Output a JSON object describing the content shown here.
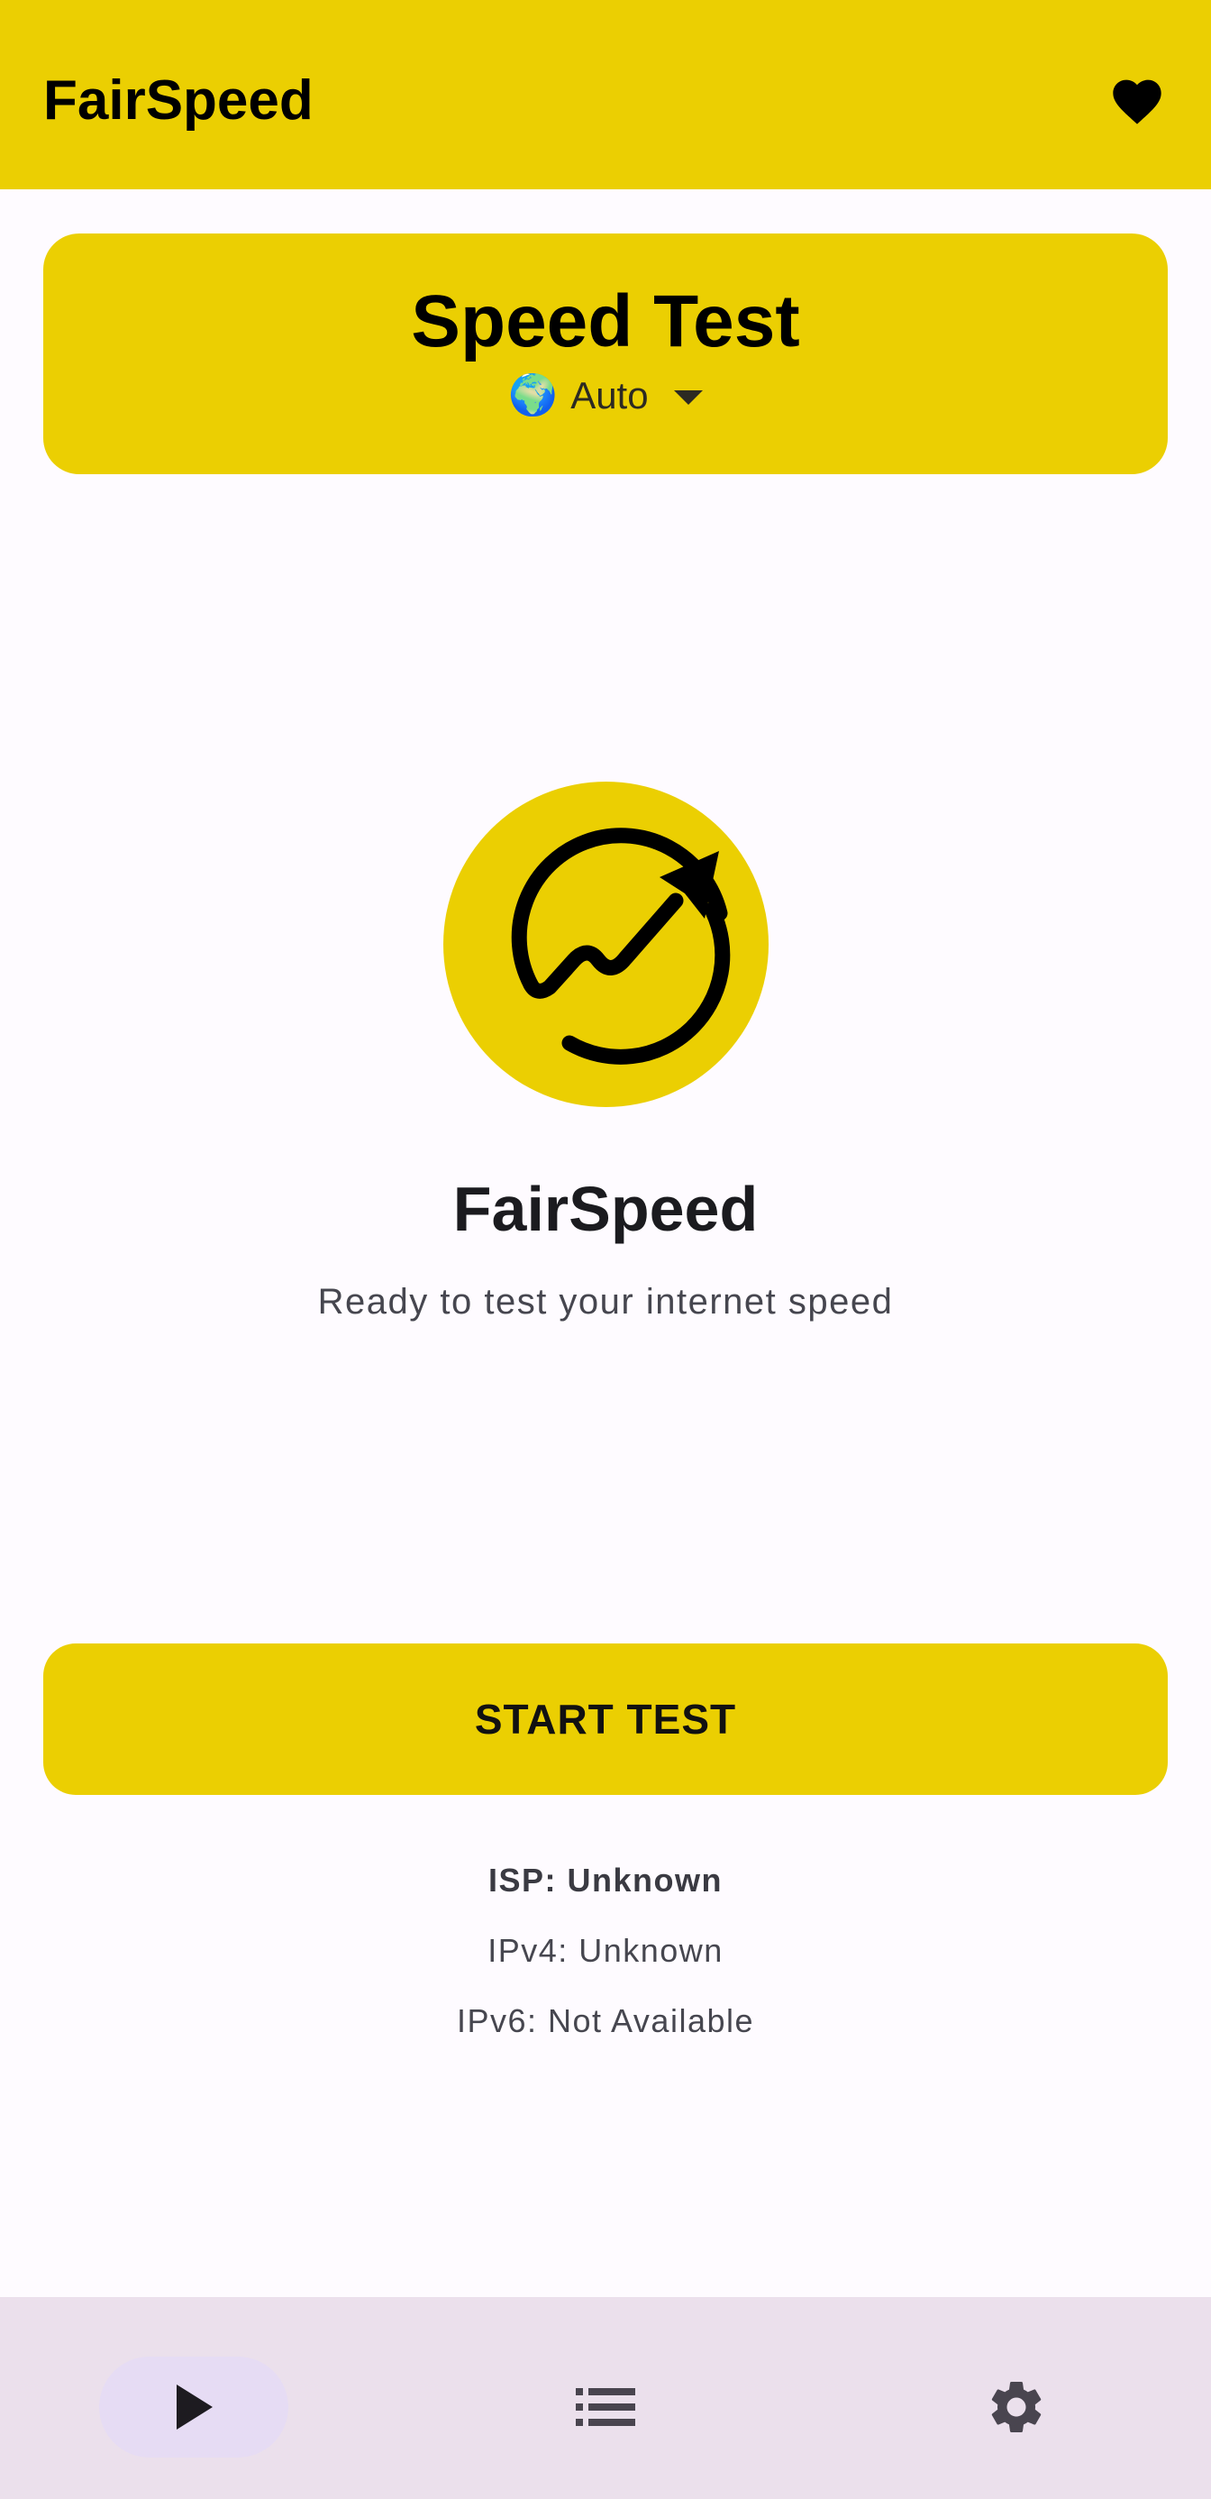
{
  "app_bar": {
    "title": "FairSpeed",
    "favorite_icon": "heart-icon"
  },
  "speed_card": {
    "title": "Speed Test",
    "server": {
      "flag_icon": "🌍",
      "selected": "Auto",
      "dropdown_icon": "caret-down-icon"
    }
  },
  "hero": {
    "logo_icon": "fairspeed-logo-icon",
    "brand_name": "FairSpeed",
    "status": "Ready to test your internet speed"
  },
  "start_button": {
    "label": "START TEST"
  },
  "connection_info": {
    "isp": "ISP: Unknown",
    "ipv4": "IPv4: Unknown",
    "ipv6": "IPv6: Not Available"
  },
  "bottom_nav": {
    "items": [
      {
        "icon": "play-icon",
        "active": true
      },
      {
        "icon": "list-icon",
        "active": false
      },
      {
        "icon": "gear-icon",
        "active": false
      }
    ]
  },
  "colors": {
    "accent": "#ebcf02",
    "background": "#fefbff",
    "nav_background": "#ebe0ec",
    "nav_active_pill": "#e6dcf4"
  }
}
